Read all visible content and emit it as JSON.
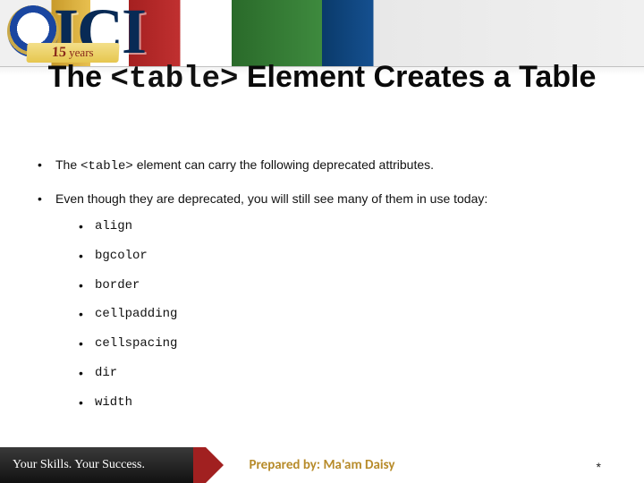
{
  "banner": {
    "brand": "ICI",
    "ribbon_years": "15",
    "ribbon_text": "years"
  },
  "title": {
    "pre": "The ",
    "code": "<table>",
    "post": " Element Creates a Table"
  },
  "bullets": [
    {
      "pre": "The  ",
      "code": "<table>",
      "post": "  element can carry the following deprecated attributes."
    },
    {
      "pre": "Even though they are deprecated, you will still see many of them in use today:",
      "code": "",
      "post": ""
    }
  ],
  "attributes": [
    "align",
    "bgcolor",
    "border",
    "cellpadding",
    "cellspacing",
    "dir",
    "width"
  ],
  "footer": {
    "tagline": "Your Skills. Your Success.",
    "prepared": "Prepared by: Ma'am Daisy",
    "marker": "*"
  }
}
